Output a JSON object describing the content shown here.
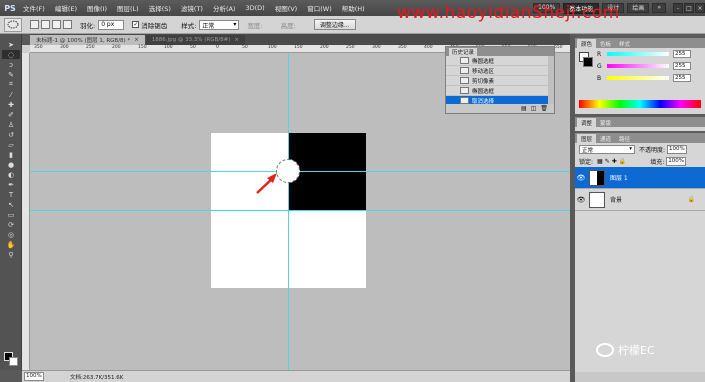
{
  "app": {
    "logo": "PS"
  },
  "menu": {
    "items": [
      "文件(F)",
      "编辑(E)",
      "图像(I)",
      "图层(L)",
      "选择(S)",
      "滤镜(T)",
      "分析(A)",
      "3D(D)",
      "视图(V)",
      "窗口(W)",
      "帮助(H)"
    ]
  },
  "menubar_tools": {
    "zoom": "100%",
    "workspace": "基本功能",
    "design": "设计",
    "paint": "绘画",
    "more": "»"
  },
  "window_controls": [
    "-",
    "□",
    "×"
  ],
  "watermark": "www.haoyidianSheji.com",
  "options": {
    "feather_label": "羽化:",
    "feather_value": "0 px",
    "antialias_label": "消除锯齿",
    "style_label": "样式:",
    "style_value": "正常",
    "width_label": "宽度:",
    "height_label": "高度:",
    "refine_label": "调整边缘..."
  },
  "tabs": [
    {
      "label": "未标题-1 @ 100% (图层 1, RGB/8) *",
      "active": true
    },
    {
      "label": "1886.jpg @ 33.3% (RGB/8#)",
      "active": false
    }
  ],
  "ruler_top": [
    "350",
    "300",
    "250",
    "200",
    "150",
    "100",
    "50",
    "0",
    "50",
    "100",
    "150",
    "200",
    "250",
    "300",
    "350",
    "400",
    "450",
    "500",
    "550",
    "600",
    "650"
  ],
  "history": {
    "tabs": [
      "历史记录",
      "动作"
    ],
    "rows": [
      {
        "label": "椭圆选框",
        "active": false
      },
      {
        "label": "移动选区",
        "active": false
      },
      {
        "label": "剪切像素",
        "active": false
      },
      {
        "label": "椭圆选框",
        "active": false
      },
      {
        "label": "取消选择",
        "active": true
      }
    ]
  },
  "color_panel": {
    "tabs": [
      "颜色",
      "色板",
      "样式"
    ],
    "rows": [
      {
        "label": "R",
        "value": "255"
      },
      {
        "label": "G",
        "value": "255"
      },
      {
        "label": "B",
        "value": "255"
      }
    ]
  },
  "adjust_panel": {
    "tabs": [
      "调整",
      "蒙版"
    ]
  },
  "layers_panel": {
    "tabs": [
      "图层",
      "通道",
      "路径"
    ],
    "blend_mode": "正常",
    "opacity_label": "不透明度:",
    "opacity_value": "100%",
    "lock_label": "锁定:",
    "fill_label": "填充:",
    "fill_value": "100%",
    "layers": [
      {
        "name": "图层 1",
        "active": true
      },
      {
        "name": "背景",
        "active": false
      }
    ]
  },
  "status": {
    "zoom": "100%",
    "doc_info": "文档:263.7K/351.6K"
  },
  "social": {
    "label": "柠檬EC"
  }
}
